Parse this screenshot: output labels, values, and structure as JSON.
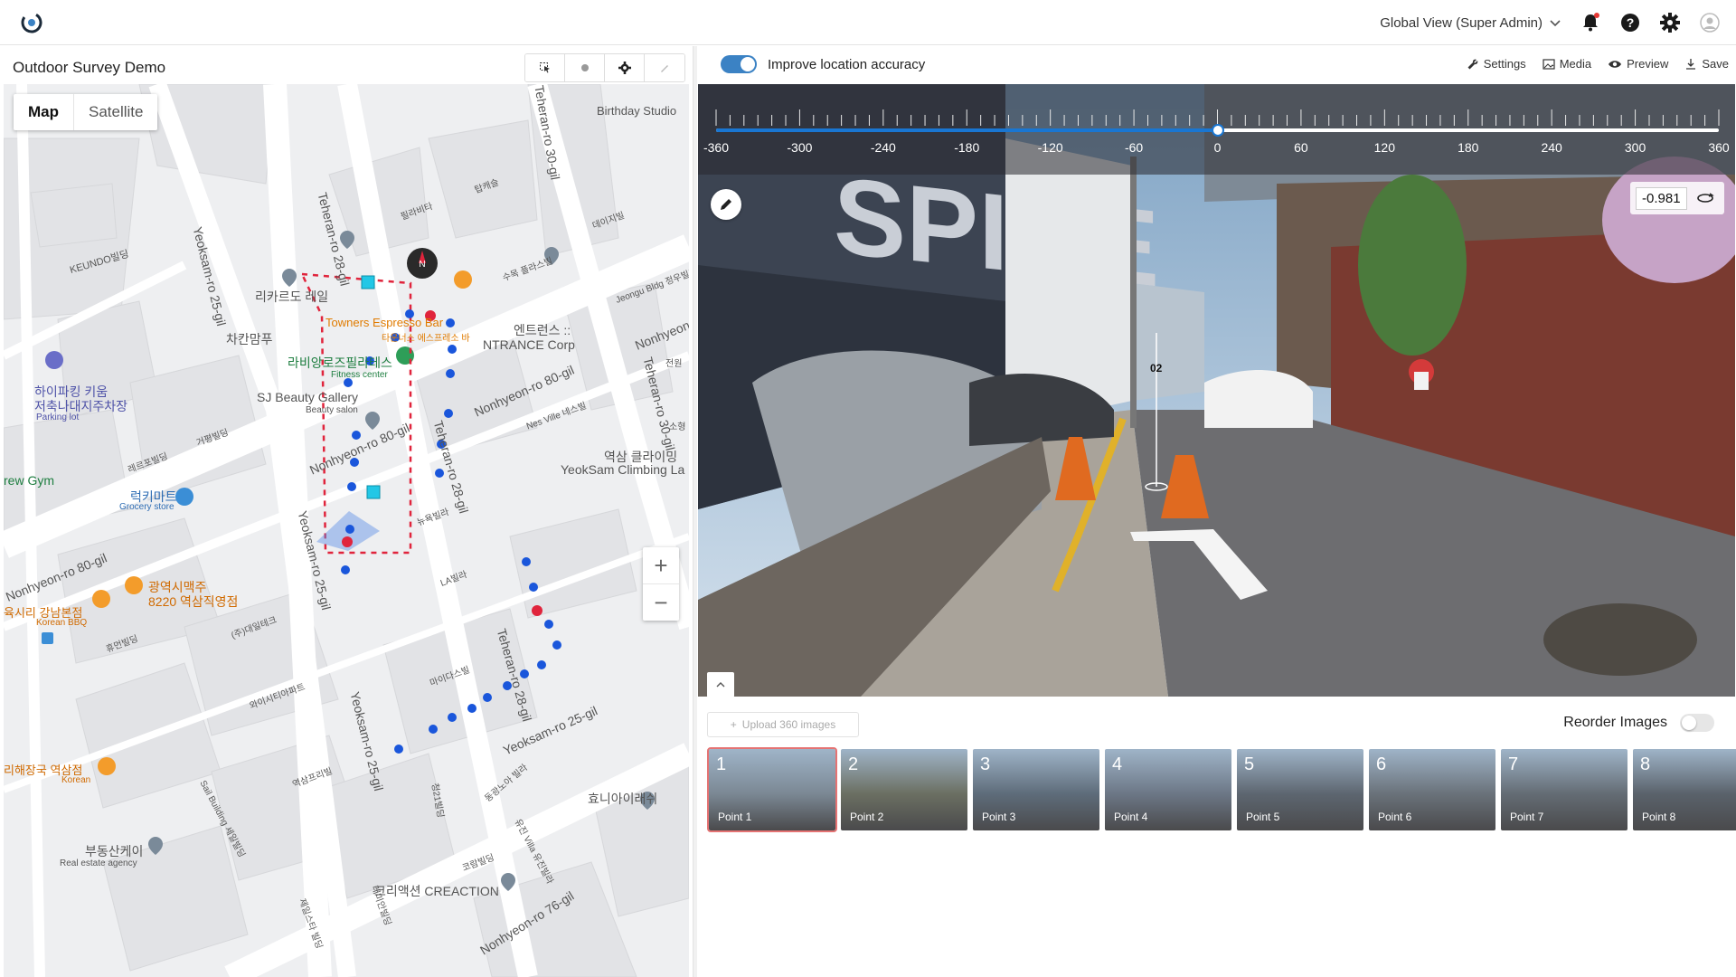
{
  "header": {
    "view_label": "Global View (Super Admin)"
  },
  "left_panel": {
    "project_title": "Outdoor Survey Demo",
    "map_types": [
      "Map",
      "Satellite"
    ],
    "zoom_in": "+",
    "zoom_out": "−",
    "compass_letter": "N",
    "streets": {
      "s1": "Teheran-ro 28-gil",
      "s2": "Teheran-ro 28-gil",
      "s3": "Teheran-ro 28-gil",
      "s4": "Yeoksam-ro 25-gil",
      "s5": "Yeoksam-ro 25-gil",
      "s6": "Yeoksam-ro 25-gil",
      "s7": "Yeoksam-ro 25-gil",
      "s8": "Teheran-ro 30-gil",
      "s9": "Teheran-ro 30-gil",
      "s10": "Nonhyeon-ro 80-gil",
      "s11": "Nonhyeon-ro 80-gil",
      "s12": "Nonhyeon-ro 80-gil",
      "s13": "Nonhyeon-ro 76-gil",
      "s14": "Nonhyeon"
    },
    "places": {
      "birthday": "Birthday Studio",
      "keundo": "KEUNDO빌딩",
      "richard": "리카르도 레일",
      "chakan": "차칸맘푸",
      "towners": "Towners Espresso Bar",
      "towners_kr": "타운너스 에스프레소 바",
      "entrance_kr": "엔트런스 ::",
      "entrance": "NTRANCE Corp",
      "pilates_kr": "라비앙로즈필라테스",
      "pilates": "Fitness center",
      "parking_kr": "하이파킹 키움",
      "parking_kr2": "저축나대지주차장",
      "parking": "Parking lot",
      "beauty": "SJ Beauty Gallery",
      "beauty_sub": "Beauty salon",
      "grocery_kr": "럭키마트",
      "grocery": "Grocery store",
      "climbing_kr": "역삼 클라이밍",
      "climbing": "YeokSam Climbing La",
      "gym": "rew Gym",
      "beer_kr": "광역시맥주",
      "beer_kr2": "8220 역삼직영점",
      "bbq_kr": "육시리 강남본점",
      "bbq": "Korean BBQ",
      "haejang_kr": "리해장국 역삼점",
      "haejang": "Korean",
      "realestate_kr": "부동산케이",
      "realestate": "Real estate agency",
      "creaction": "크리액션 CREACTION",
      "hyoni": "효니아이래쉬",
      "nesville": "Nes Ville 네스빌",
      "dalbit": "데이지빌",
      "jeongu": "Jeongu Bldg 정우빌딩",
      "tapkwell": "탑캐슬",
      "chilbichi": "필라비타",
      "hanwool": "수목 플라스빌",
      "jeonwon": "전원",
      "jooteak": "소형",
      "rerebil": "레르포빌딩",
      "keopyeong": "거평빌딩",
      "yulyeo": "휴먼빌딩",
      "daeil": "(주)대일테크",
      "wisiti": "와이시티아파트",
      "yeoksam_pr": "역삼프리빌",
      "saint": "Sail Building 세일빌딩",
      "nyeok": "뉴욕빌라",
      "la": "LA빌라",
      "maidas": "마이다스빌",
      "donggwang": "동광노아 빌라",
      "kimsan": "유진 Villa 유진빌라",
      "koreabil": "코람빌딩",
      "samsung": "청21빌딩",
      "raemian": "래미안빌딩",
      "gyeolhon": "제일스타 빌딩"
    }
  },
  "right_panel": {
    "improve_label": "Improve location accuracy",
    "actions": {
      "settings": "Settings",
      "media": "Media",
      "preview": "Preview",
      "save": "Save"
    },
    "viewer": {
      "slider_ticks": [
        "-360",
        "-300",
        "-240",
        "-180",
        "-120",
        "-60",
        "0",
        "60",
        "120",
        "180",
        "240",
        "300",
        "360"
      ],
      "slider_min": -360,
      "slider_max": 360,
      "slider_value": 0,
      "heading_value": "-0.981",
      "building_sign": "SPIRE",
      "marker_label": "02"
    },
    "upload_label": "Upload 360 images",
    "reorder_label": "Reorder Images",
    "thumbnails": [
      {
        "num": "1",
        "label": "Point 1"
      },
      {
        "num": "2",
        "label": "Point 2"
      },
      {
        "num": "3",
        "label": "Point 3"
      },
      {
        "num": "4",
        "label": "Point 4"
      },
      {
        "num": "5",
        "label": "Point 5"
      },
      {
        "num": "6",
        "label": "Point 6"
      },
      {
        "num": "7",
        "label": "Point 7"
      },
      {
        "num": "8",
        "label": "Point 8"
      }
    ]
  },
  "colors": {
    "accent": "#1976d2",
    "route_blue": "#1a56db",
    "route_red": "#e0243c",
    "marker_cyan": "#22c7e6",
    "toggle_on": "#3b82c4"
  }
}
